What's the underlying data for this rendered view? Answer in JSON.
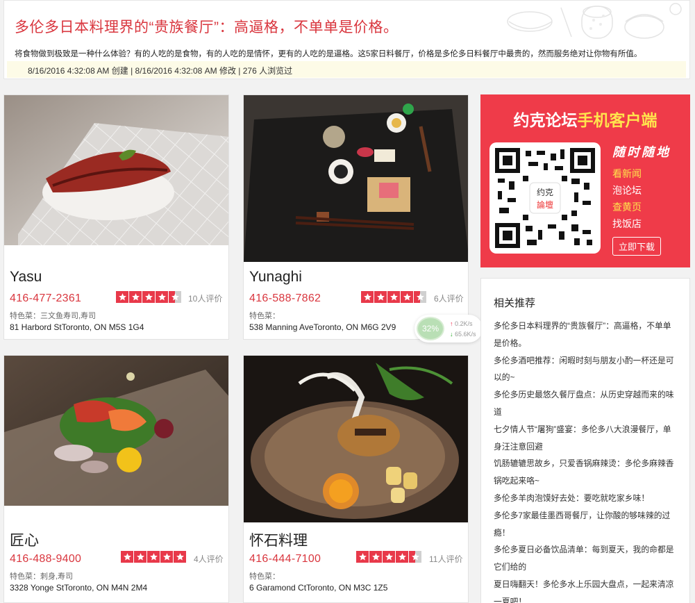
{
  "header": {
    "title": "多伦多日本料理界的“贵族餐厅”：高逼格，不单单是价格。",
    "description": "将食物做到极致是一种什么体验？有的人吃的是食物，有的人吃的是情怀，更有的人吃的是逼格。这5家日料餐厅，价格是多伦多日料餐厅中最贵的，然而服务绝对让你物有所值。",
    "meta": "8/16/2016 4:32:08 AM 创建 | 8/16/2016 4:32:08 AM 修改 | 276 人浏览过"
  },
  "restaurants": [
    {
      "name": "Yasu",
      "phone": "416-477-2361",
      "rating": 4.5,
      "reviews": "10人评价",
      "dishes": "特色菜：三文鱼寿司,寿司",
      "address": "81 Harbord StToronto, ON M5S 1G4"
    },
    {
      "name": "Yunaghi",
      "phone": "416-588-7862",
      "rating": 4.5,
      "reviews": "6人评价",
      "dishes": "特色菜：",
      "address": "538 Manning AveToronto, ON M6G 2V9"
    },
    {
      "name": "匠心",
      "phone": "416-488-9400",
      "rating": 5,
      "reviews": "4人评价",
      "dishes": "特色菜：刺身,寿司",
      "address": "3328 Yonge StToronto, ON M4N 2M4"
    },
    {
      "name": "怀石料理",
      "phone": "416-444-7100",
      "rating": 4.5,
      "reviews": "11人评价",
      "dishes": "特色菜：",
      "address": "6 Garamond CtToronto, ON M3C 1Z5"
    }
  ],
  "ad": {
    "title_prefix": "约克论坛",
    "title_highlight": "手机客户端",
    "slogan": "随时随地",
    "items": [
      "看新闻",
      "泡论坛",
      "查黄页",
      "找饭店"
    ],
    "download": "立即下载",
    "qr_logo_top": "约克",
    "qr_logo_bottom": "論壇"
  },
  "related": {
    "heading": "相关推荐",
    "items": [
      "多伦多日本料理界的“贵族餐厅”：高逼格，不单单是价格。",
      "多伦多酒吧推荐：闲暇时刻与朋友小酌一杯还是可以的~",
      "多伦多历史最悠久餐厅盘点：从历史穿越而来的味道",
      "七夕情人节“屠狗”盛宴：多伦多八大浪漫餐厅，单身汪注意回避",
      "饥肠辘辘思故乡，只爱香锅麻辣烫：多伦多麻辣香锅吃起来咯~",
      "多伦多羊肉泡馍好去处：要吃就吃家乡味！",
      "多伦多7家最佳墨西哥餐厅，让你酸的够味辣的过瘾！",
      "多伦多夏日必备饮品清单：每到夏天，我的命都是它们给的",
      "夏日嗨翻天！多伦多水上乐园大盘点，一起来清凉一夏吧！"
    ]
  },
  "speed_widget": {
    "percent": "32%",
    "upload": "0.2K/s",
    "download": "65.6K/s"
  },
  "colors": {
    "accent_red": "#d9363e",
    "star_red": "#e8394a",
    "ad_bg": "#ef3b49",
    "ad_yellow": "#ffe44d"
  }
}
